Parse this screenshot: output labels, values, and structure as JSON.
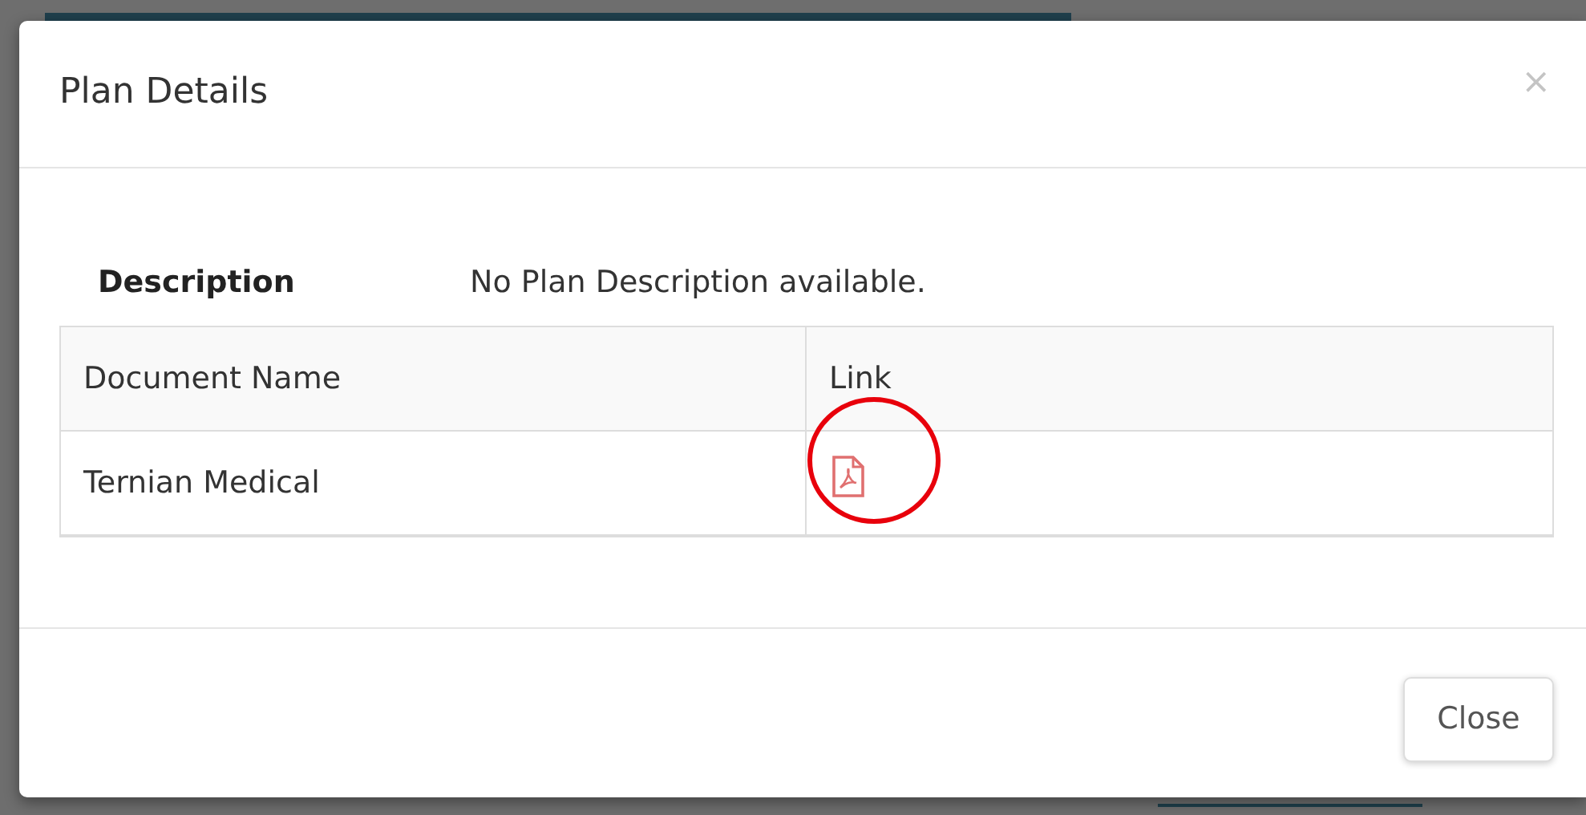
{
  "modal": {
    "title": "Plan Details",
    "close_glyph": "×"
  },
  "description": {
    "label": "Description",
    "value": "No Plan Description available."
  },
  "table": {
    "columns": [
      "Document Name",
      "Link"
    ],
    "rows": [
      {
        "document_name": "Ternian Medical",
        "link": {
          "kind": "pdf"
        }
      }
    ]
  },
  "footer": {
    "buttons": [
      "Close"
    ]
  }
}
